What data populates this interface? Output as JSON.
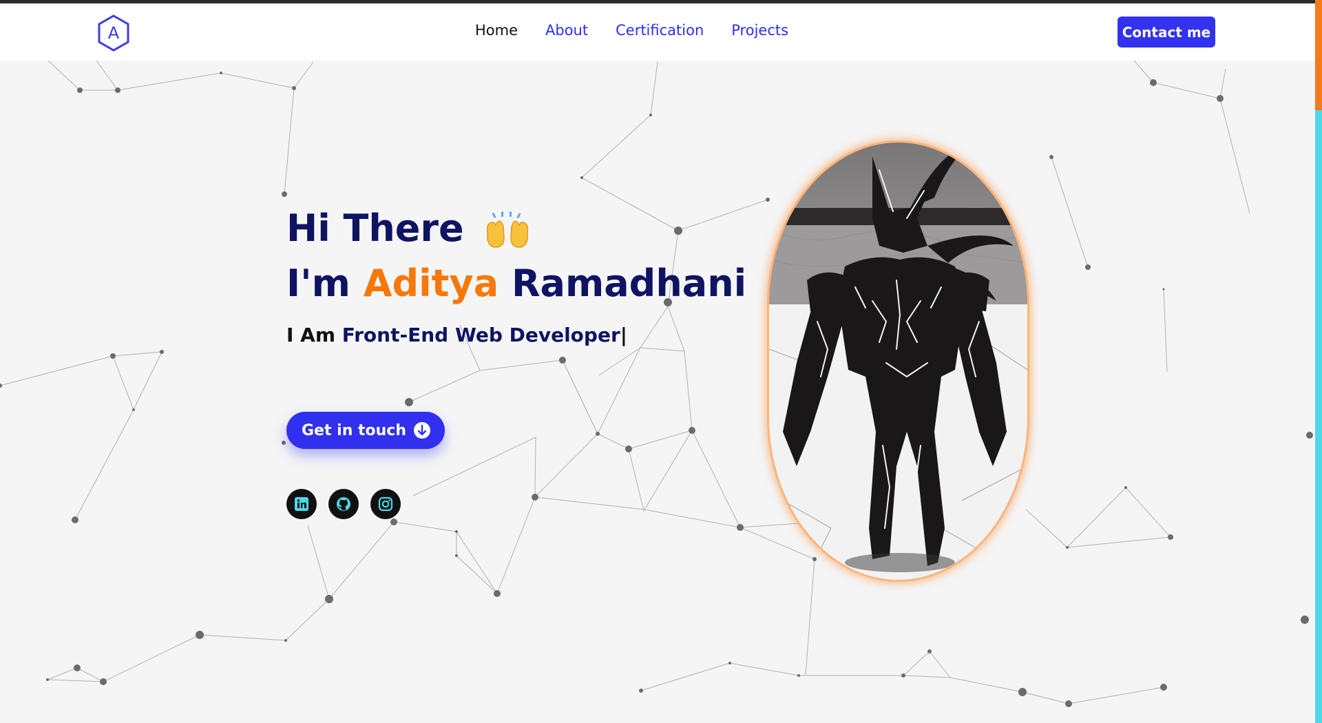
{
  "nav": {
    "logo_letter": "A",
    "links": [
      {
        "label": "Home",
        "active": true
      },
      {
        "label": "About",
        "active": false
      },
      {
        "label": "Certification",
        "active": false
      },
      {
        "label": "Projects",
        "active": false
      }
    ],
    "contact_label": "Contact me"
  },
  "hero": {
    "greeting": "Hi There",
    "greeting_emoji": "raising-hands-icon",
    "name_prefix": "I'm",
    "first_name": "Aditya",
    "last_name": "Ramadhani",
    "role_prefix": "I Am",
    "role": "Front-End Web Developer",
    "cursor": "|",
    "cta_label": "Get in touch",
    "socials": [
      "linkedin-icon",
      "github-icon",
      "instagram-icon"
    ]
  },
  "colors": {
    "primary": "#3232f0",
    "navy": "#0e1461",
    "accent": "#f6780a",
    "background": "#f5f5f6",
    "scrollbar_track": "#4dd8ea",
    "scrollbar_thumb": "#f47a1c"
  }
}
